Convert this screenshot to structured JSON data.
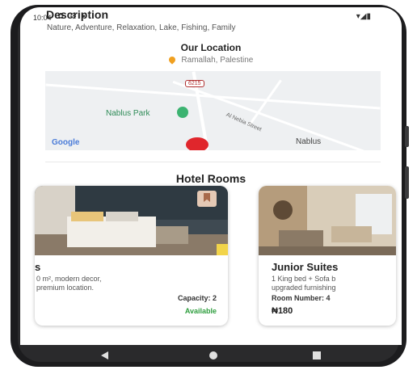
{
  "status_bar": {
    "time": "10:04",
    "left_icons": "✿ ⚙ ▪",
    "right_icons": "▾◢▮"
  },
  "description": {
    "title": "Description",
    "tags": "Nature, Adventure, Relaxation, Lake, Fishing, Family"
  },
  "location": {
    "title": "Our Location",
    "place": "Ramallah, Palestine",
    "icon": "location-pin-icon"
  },
  "map": {
    "park_label": "Nablus Park",
    "road_shield": "6215",
    "street_label": "Al Nebia Street",
    "city_label": "Nablus",
    "logo": "Google"
  },
  "rooms": {
    "title": "Hotel Rooms",
    "items": [
      {
        "name": "s",
        "desc_line1": "0 m², modern decor,",
        "desc_line2": "premium location.",
        "capacity": "Capacity: 2",
        "status": "Available"
      },
      {
        "name": "Junior Suites",
        "desc_line1": "1 King bed + Sofa b",
        "desc_line2": "upgraded furnishing",
        "room_number": "Room Number: 4",
        "price": "₦180"
      }
    ]
  },
  "colors": {
    "available": "#2e9e3e",
    "pin": "#f0a020",
    "marker": "#e0262c"
  }
}
